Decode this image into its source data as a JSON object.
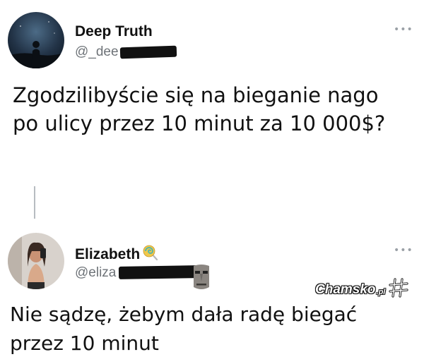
{
  "tweet": {
    "author_name": "Deep Truth",
    "author_handle": "@_dee",
    "more_icon": "more-dots-icon",
    "text": "Zgodzilibyście się na bieganie nago po ulicy przez 10 minut za 10 000$?"
  },
  "reply": {
    "author_name": "Elizabeth",
    "name_emoji": "lollipop-icon",
    "author_handle": "@eliza",
    "more_icon": "more-dots-icon",
    "text": "Nie sądzę, żebym dała radę biegać przez 10 minut"
  },
  "watermark": {
    "text": "Chamsko",
    "suffix": ".pl"
  },
  "colors": {
    "background": "#ffffff",
    "text": "#111111",
    "handle": "#6e7378",
    "thread_line": "#b7bcc1"
  }
}
